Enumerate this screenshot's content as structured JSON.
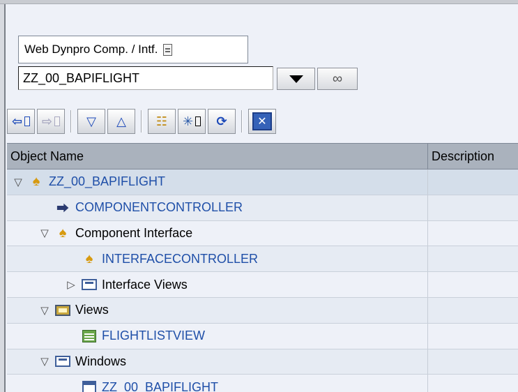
{
  "object_type": {
    "label": "Web Dynpro Comp. / Intf."
  },
  "object_name": {
    "value": "ZZ_00_BAPIFLIGHT"
  },
  "toolbar": {
    "icons": [
      "back-arrow-icon",
      "forward-arrow-icon",
      "expand-all-icon",
      "collapse-all-icon",
      "hierarchy-icon",
      "settings-icon",
      "refresh-icon",
      "close-icon"
    ]
  },
  "grid": {
    "headers": {
      "name": "Object Name",
      "description": "Description"
    },
    "rows": [
      {
        "label": "ZZ_00_BAPIFLIGHT",
        "indent": 0,
        "expander": "open",
        "icon": "component-icon",
        "link": true,
        "row_style": "sel"
      },
      {
        "label": "COMPONENTCONTROLLER",
        "indent": 1,
        "expander": "none",
        "icon": "controller-icon",
        "link": true,
        "row_style": "odd"
      },
      {
        "label": "Component Interface",
        "indent": 1,
        "expander": "open",
        "icon": "component-icon",
        "link": false,
        "row_style": "even"
      },
      {
        "label": "INTERFACECONTROLLER",
        "indent": 2,
        "expander": "none",
        "icon": "component-icon",
        "link": true,
        "row_style": "odd"
      },
      {
        "label": "Interface Views",
        "indent": 2,
        "expander": "closed",
        "icon": "window-icon",
        "link": false,
        "row_style": "even"
      },
      {
        "label": "Views",
        "indent": 1,
        "expander": "open",
        "icon": "views-folder-icon",
        "link": false,
        "row_style": "odd"
      },
      {
        "label": "FLIGHTLISTVIEW",
        "indent": 2,
        "expander": "none",
        "icon": "view-icon",
        "link": true,
        "row_style": "even"
      },
      {
        "label": "Windows",
        "indent": 1,
        "expander": "open",
        "icon": "window-icon",
        "link": false,
        "row_style": "odd"
      },
      {
        "label": "ZZ_00_BAPIFLIGHT",
        "indent": 2,
        "expander": "none",
        "icon": "window-single-icon",
        "link": true,
        "row_style": "even"
      }
    ]
  },
  "colors": {
    "background": "#eef1f8",
    "header": "#aab2bd",
    "selected_row": "#d4deea",
    "link_text": "#1f4fa8"
  }
}
